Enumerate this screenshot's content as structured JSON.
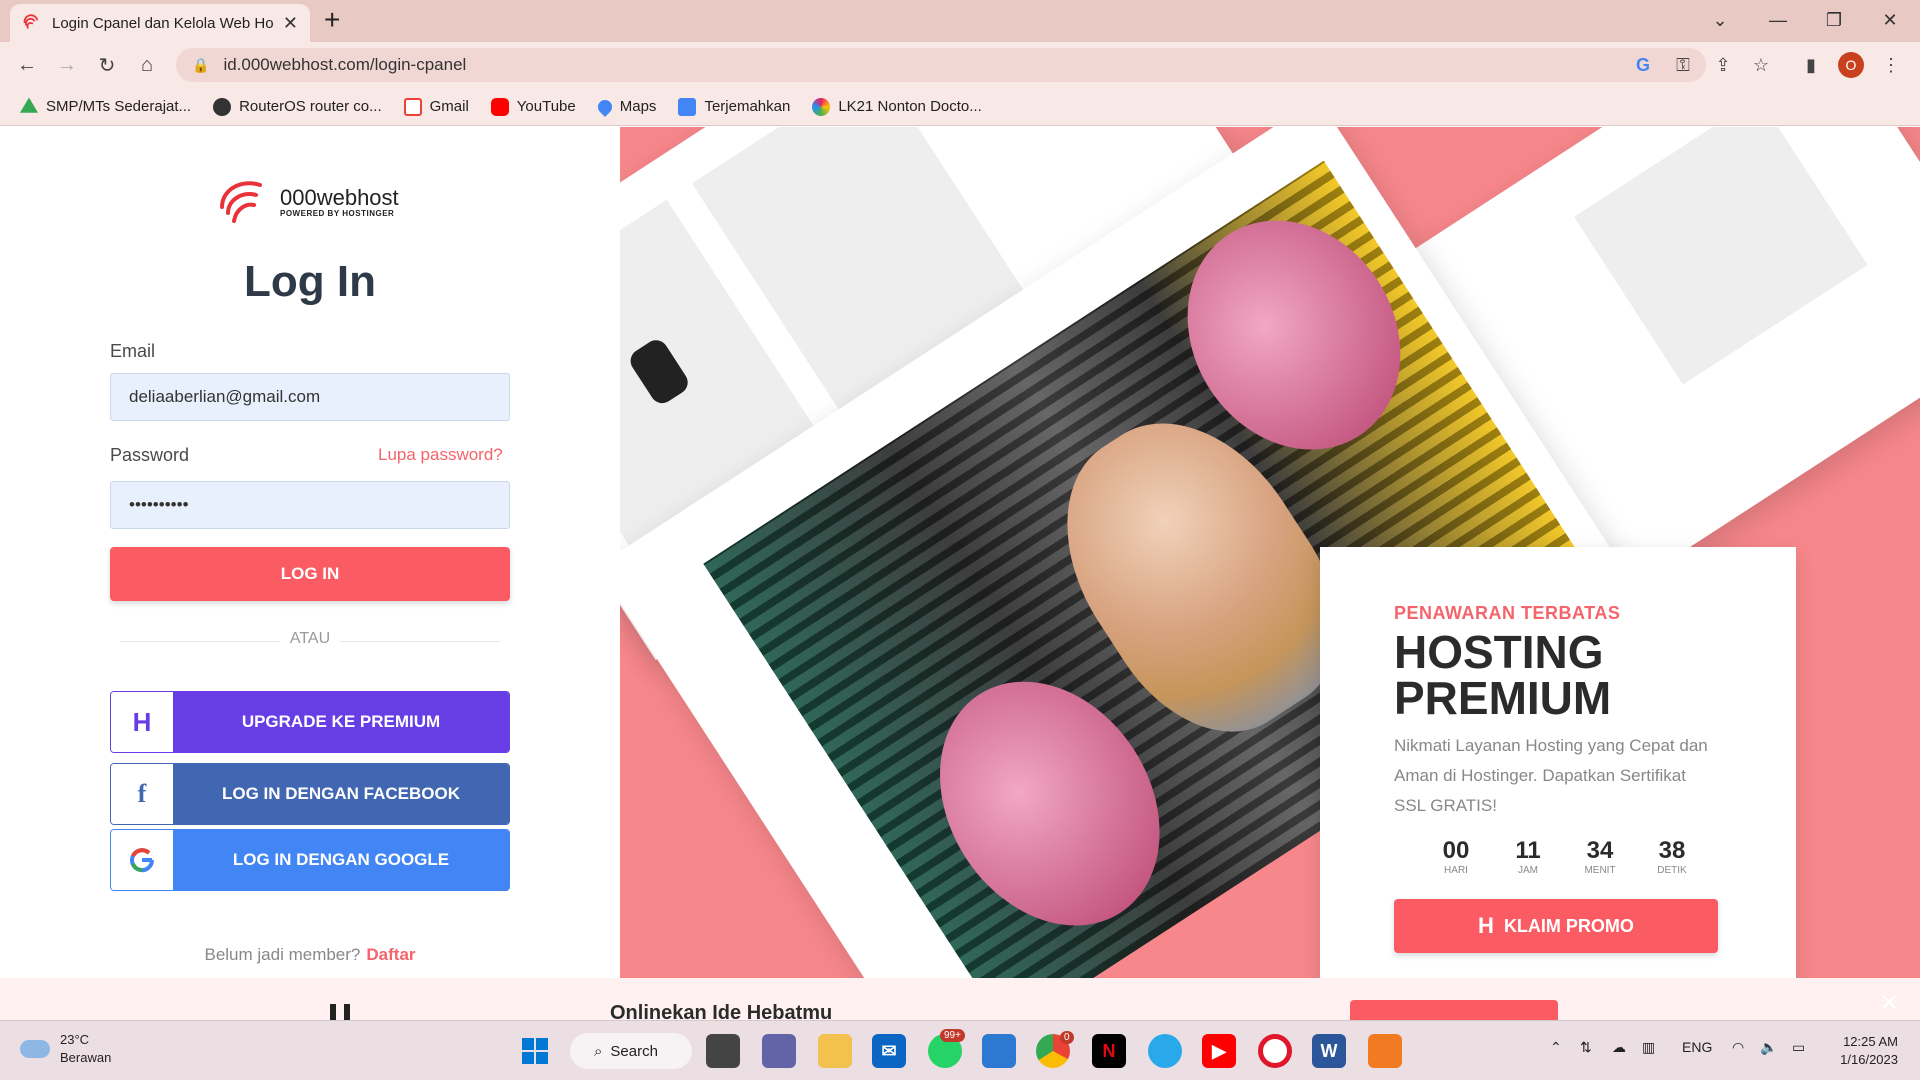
{
  "browser": {
    "tab_title": "Login Cpanel dan Kelola Web Ho",
    "new_tab": "+",
    "tab_close": "✕",
    "url": "id.000webhost.com/login-cpanel",
    "profile_initial": "O",
    "bookmarks": [
      {
        "label": "SMP/MTs Sederajat...",
        "icon": "google-drive-icon",
        "color": "#34a853"
      },
      {
        "label": "RouterOS router co...",
        "icon": "globe-icon",
        "color": "#333333"
      },
      {
        "label": "Gmail",
        "icon": "gmail-icon",
        "color": "#ea4335"
      },
      {
        "label": "YouTube",
        "icon": "youtube-icon",
        "color": "#ff0000"
      },
      {
        "label": "Maps",
        "icon": "maps-icon",
        "color": "#4285f4"
      },
      {
        "label": "Terjemahkan",
        "icon": "translate-icon",
        "color": "#4285f4"
      },
      {
        "label": "LK21 Nonton Docto...",
        "icon": "lk21-icon",
        "color": "#e91e63"
      }
    ]
  },
  "login": {
    "brand_name": "000webhost",
    "brand_sub": "POWERED BY HOSTINGER",
    "title": "Log In",
    "email_label": "Email",
    "email_value": "deliaaberlian@gmail.com",
    "password_label": "Password",
    "forgot": "Lupa password?",
    "password_value": "••••••••••",
    "login_button": "LOG IN",
    "or": "ATAU",
    "upgrade_button": "UPGRADE KE PREMIUM",
    "facebook_button": "LOG IN DENGAN FACEBOOK",
    "google_button": "LOG IN DENGAN GOOGLE",
    "member_text": "Belum jadi member?",
    "register_link": "Daftar"
  },
  "promo": {
    "eyebrow": "PENAWARAN TERBATAS",
    "headline": "HOSTING PREMIUM",
    "description": "Nikmati Layanan Hosting yang Cepat dan Aman di Hostinger. Dapatkan Sertifikat SSL GRATIS!",
    "countdown": [
      {
        "value": "00",
        "unit": "HARI"
      },
      {
        "value": "11",
        "unit": "JAM"
      },
      {
        "value": "34",
        "unit": "MENIT"
      },
      {
        "value": "38",
        "unit": "DETIK"
      }
    ],
    "cta": "KLAIM PROMO"
  },
  "banner": {
    "text": "Onlinekan Ide Hebatmu"
  },
  "taskbar": {
    "temperature": "23°C",
    "condition": "Berawan",
    "search": "Search",
    "whatsapp_badge": "99+",
    "chrome_badge": "0",
    "language": "ENG",
    "time": "12:25 AM",
    "date": "1/16/2023"
  },
  "colors": {
    "accent": "#fb5b63",
    "upgrade": "#673de6",
    "facebook": "#4267b2",
    "google": "#4285f4",
    "hero": "#f7878b"
  }
}
